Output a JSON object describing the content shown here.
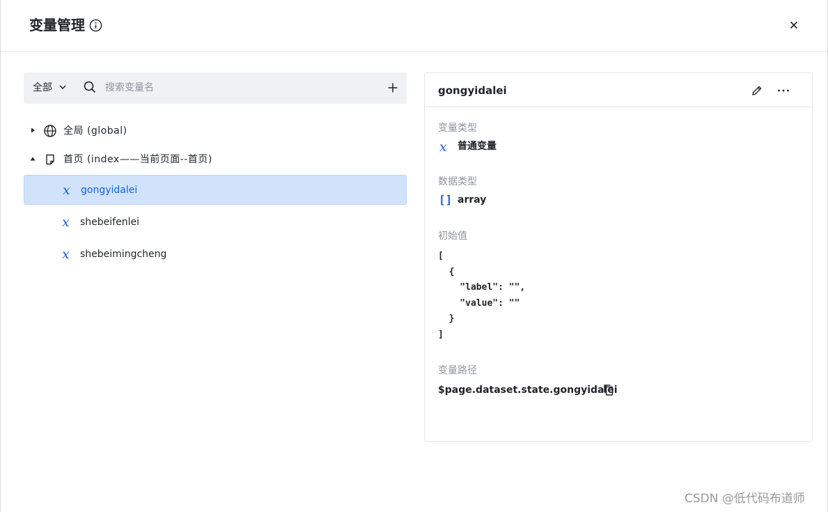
{
  "dialog": {
    "title": "变量管理",
    "info_icon": "info-circle-icon",
    "close_icon": "close-icon"
  },
  "left_panel": {
    "filter_label": "全部",
    "search_placeholder": "搜索变量名",
    "tree": [
      {
        "label": "全局 (global)",
        "icon": "globe-icon",
        "expanded": false
      },
      {
        "label": "首页 (index——当前页面--首页)",
        "icon": "page-icon",
        "expanded": true
      }
    ],
    "variables": [
      {
        "name": "gongyidalei",
        "selected": true
      },
      {
        "name": "shebeifenlei",
        "selected": false
      },
      {
        "name": "shebeimingcheng",
        "selected": false
      }
    ]
  },
  "detail": {
    "name": "gongyidalei",
    "var_type_label": "变量类型",
    "var_type_value": "普通变量",
    "data_type_label": "数据类型",
    "data_type_value": "array",
    "initial_value_label": "初始值",
    "initial_value": "[\n  {\n    \"label\": \"\",\n    \"value\": \"\"\n  }\n]",
    "path_label": "变量路径",
    "path_value": "$page.dataset.state.gongyidalei"
  },
  "watermark": "CSDN @低代码布道师",
  "colors": {
    "accent": "#1364d8",
    "selected_bg": "#d1e2fb",
    "toolbar_bg": "#f0f1f5",
    "muted_text": "#8f959e"
  }
}
